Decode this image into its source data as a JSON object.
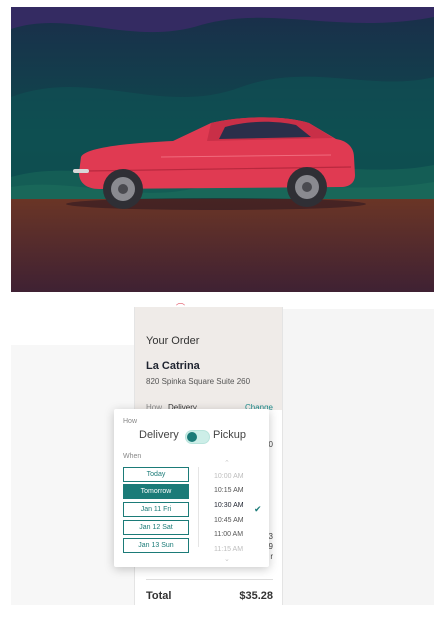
{
  "topbar": {
    "fragment": "⌒ ·"
  },
  "order": {
    "title": "Your Order",
    "restaurant": "La Catrina",
    "address": "820 Spinka Square Suite 260",
    "how_label": "How",
    "how_value": "Delivery",
    "change": "Change",
    "total_label": "Total",
    "total_value": "$35.28",
    "hidden_fragments": [
      "0",
      "3",
      "9",
      "r"
    ]
  },
  "popup": {
    "how_label": "How",
    "delivery": "Delivery",
    "pickup": "Pickup",
    "mode": "delivery",
    "when_label": "When",
    "days": [
      "Today",
      "Tomorrow",
      "Jan 11 Fri",
      "Jan 12 Sat",
      "Jan 13 Sun"
    ],
    "selected_day": "Tomorrow",
    "times": [
      "10:00 AM",
      "10:15 AM",
      "10:30 AM",
      "10:45 AM",
      "11:00 AM",
      "11:15 AM"
    ],
    "selected_time": "10:30 AM"
  },
  "icons": {
    "up": "chevron-up-icon",
    "down": "chevron-down-icon",
    "check": "check-icon"
  },
  "colors": {
    "accent": "#1b7b78",
    "car": "#e03a52",
    "sky": "#0f4a4a",
    "ground": "#6b3a2a"
  }
}
